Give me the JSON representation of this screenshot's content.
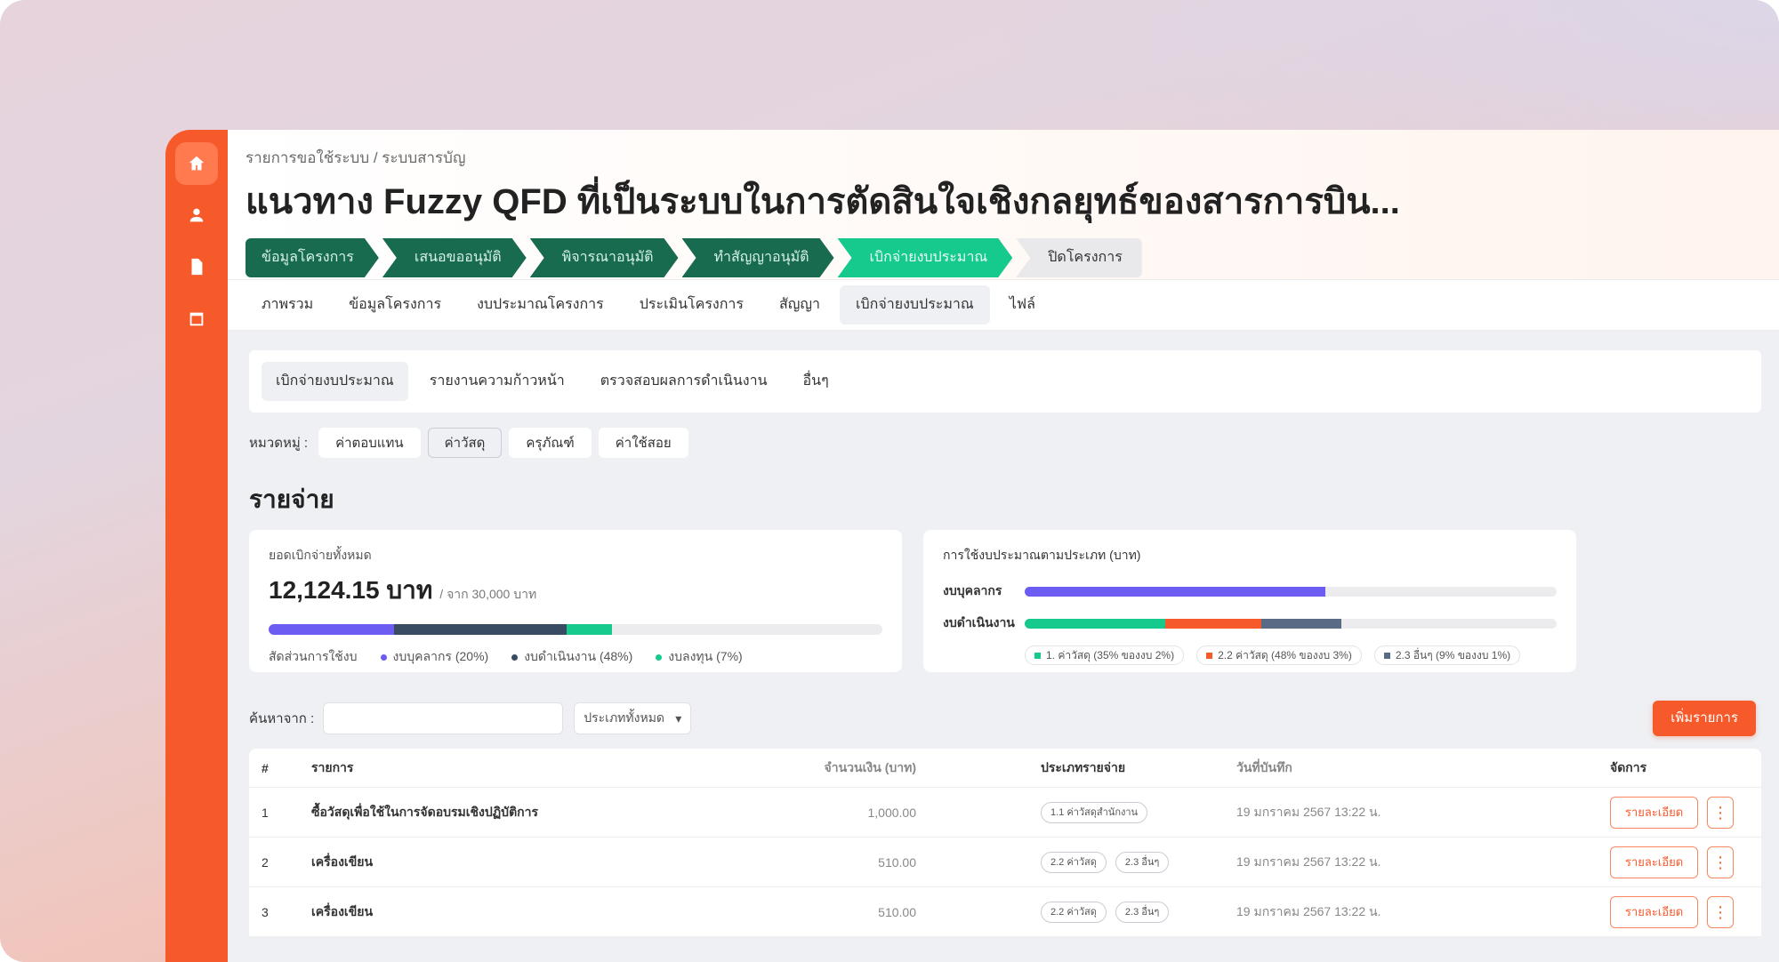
{
  "breadcrumb": "รายการขอใช้ระบบ / ระบบสารบัญ",
  "title": "แนวทาง Fuzzy QFD ที่เป็นระบบในการตัดสินใจเชิงกลยุทธ์ของสารการบิน...",
  "steps": [
    {
      "label": "ข้อมูลโครงการ"
    },
    {
      "label": "เสนอขออนุมัติ"
    },
    {
      "label": "พิจารณาอนุมัติ"
    },
    {
      "label": "ทำสัญญาอนุมัติ"
    },
    {
      "label": "เบิกจ่ายงบประมาณ"
    },
    {
      "label": "ปิดโครงการ"
    }
  ],
  "tabs": [
    {
      "label": "ภาพรวม"
    },
    {
      "label": "ข้อมูลโครงการ"
    },
    {
      "label": "งบประมาณโครงการ"
    },
    {
      "label": "ประเมินโครงการ"
    },
    {
      "label": "สัญญา"
    },
    {
      "label": "เบิกจ่ายงบประมาณ"
    },
    {
      "label": "ไฟล์"
    }
  ],
  "subtabs": [
    {
      "label": "เบิกจ่ายงบประมาณ"
    },
    {
      "label": "รายงานความก้าวหน้า"
    },
    {
      "label": "ตรวจสอบผลการดำเนินงาน"
    },
    {
      "label": "อื่นๆ"
    }
  ],
  "filter": {
    "label": "หมวดหมู่ :",
    "chips": [
      {
        "label": "ค่าตอบแทน"
      },
      {
        "label": "ค่าวัสดุ"
      },
      {
        "label": "ครุภัณฑ์"
      },
      {
        "label": "ค่าใช้สอย"
      }
    ]
  },
  "section_title": "รายจ่าย",
  "summary": {
    "label": "ยอดเบิกจ่ายทั้งหมด",
    "amount": "12,124.15 บาท",
    "amount_sub": "/ จาก 30,000 บาท",
    "progress_fractions": [
      0.205,
      0.28,
      0.075
    ],
    "colors": [
      "#6c5cf2",
      "#394a63",
      "#16c98c"
    ],
    "legend_title": "สัดส่วนการใช้งบ",
    "legend": [
      {
        "label": "งบบุคลากร (20%)",
        "color": "#6c5cf2"
      },
      {
        "label": "งบดำเนินงาน (48%)",
        "color": "#394a63"
      },
      {
        "label": "งบลงทุน (7%)",
        "color": "#16c98c"
      }
    ]
  },
  "breakdown": {
    "title": "การใช้งบประมาณตามประเภท (บาท)",
    "rows": [
      {
        "label": "งบบุคลากร",
        "fractions": [
          0.565
        ],
        "colors": [
          "#6c5cf2"
        ]
      },
      {
        "label": "งบดำเนินงาน",
        "fractions": [
          0.265,
          0.18,
          0.15
        ],
        "colors": [
          "#16c98c",
          "#f75a2a",
          "#5a6b86"
        ]
      }
    ],
    "legend": [
      {
        "label": "1. ค่าวัสดุ (35% ของงบ 2%)",
        "color": "#16c98c"
      },
      {
        "label": "2.2 ค่าวัสดุ (48% ของงบ 3%)",
        "color": "#f75a2a"
      },
      {
        "label": "2.3 อื่นๆ (9% ของงบ 1%)",
        "color": "#5a6b86"
      }
    ]
  },
  "search": {
    "label": "ค้นหาจาก :",
    "placeholder": "",
    "select_value": "ประเภททั้งหมด",
    "add_label": "เพิ่มรายการ"
  },
  "table": {
    "headers": [
      "#",
      "รายการ",
      "จำนวนเงิน (บาท)",
      "ประเภทรายจ่าย",
      "วันที่บันทึก",
      "จัดการ"
    ],
    "rows": [
      {
        "no": "1",
        "name": "ซื้อวัสดุเพื่อใช้ในการจัดอบรมเชิงปฏิบัติการ",
        "amount": "1,000.00",
        "tags": [
          "1.1 ค่าวัสดุสำนักงาน"
        ],
        "date": "19 มกราคม 2567 13:22 น.",
        "action": "รายละเอียด"
      },
      {
        "no": "2",
        "name": "เครื่องเขียน",
        "amount": "510.00",
        "tags": [
          "2.2 ค่าวัสดุ",
          "2.3 อื่นๆ"
        ],
        "date": "19 มกราคม 2567 13:22 น.",
        "action": "รายละเอียด"
      },
      {
        "no": "3",
        "name": "เครื่องเขียน",
        "amount": "510.00",
        "tags": [
          "2.2 ค่าวัสดุ",
          "2.3 อื่นๆ"
        ],
        "date": "19 มกราคม 2567 13:22 น.",
        "action": "รายละเอียด"
      }
    ]
  }
}
